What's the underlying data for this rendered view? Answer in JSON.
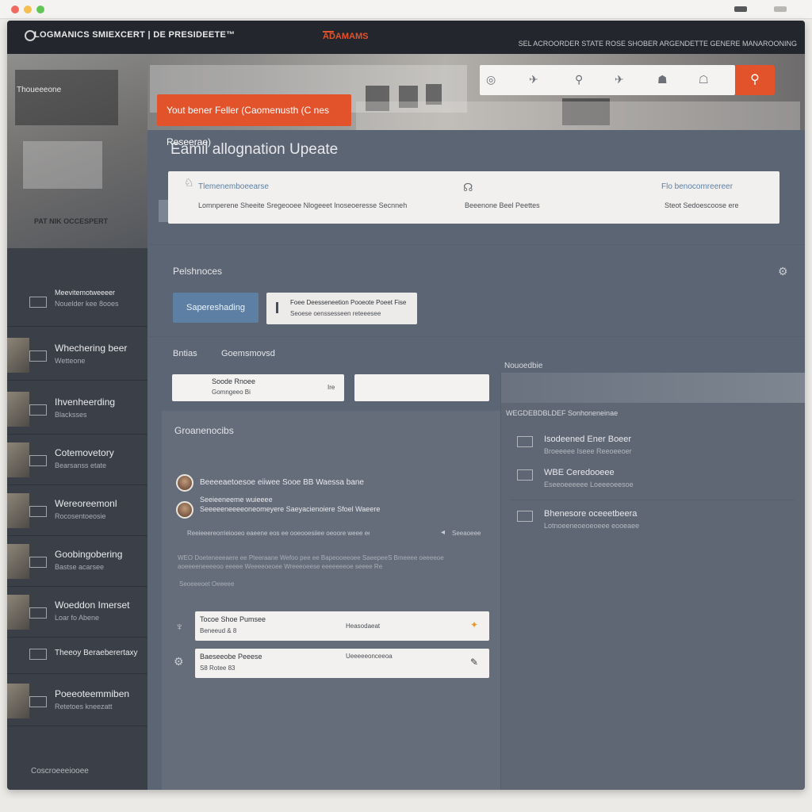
{
  "window": {
    "brand": "LOGMANICS SMIEXCERT | DE PRESIDEETE™",
    "top_nav": "ADAMAMS",
    "top_link": "SEL ACROORDER  STATE ROSE SHOBER ARGENDETTE GENERE MANAROONING"
  },
  "hero": {
    "cta": "Yout bener Feller (Caomenusth (C nes Reseerae)",
    "search_icons": [
      "◎",
      "✈",
      "⚲",
      "✈",
      "☗",
      "☖"
    ],
    "search_button": "⚲"
  },
  "sidebar": {
    "hero_title": "PAT NIK OCCESPERT",
    "hero_sub": "Thoueeeone",
    "items": [
      {
        "title": "Meevitemotweeeer",
        "sub": "Nouelder kee 8ooes"
      },
      {
        "title": "Whechering beer",
        "sub": "Wetteone"
      },
      {
        "title": "Ihvenheerding",
        "sub": "Blacksses"
      },
      {
        "title": "Cotemovetory",
        "sub": "Bearsanss etate"
      },
      {
        "title": "Wereoreemonl",
        "sub": "Rocosentoeosie"
      },
      {
        "title": "Goobingobering",
        "sub": "Bastse acarsee"
      },
      {
        "title": "Woeddon Imerset",
        "sub": "Loar fo Abene"
      },
      {
        "title": "Theeoy Beraeberertaxy",
        "sub": ""
      },
      {
        "title": "Poeeoteemmiben",
        "sub": "Retetoes kneezatt"
      }
    ],
    "footer": "Coscroeeeiooee"
  },
  "main": {
    "title": "Eamil allognation Upeate",
    "info": {
      "item1_title": "Tlemenemboeearse",
      "item1_text": "Lomnperene Sheeite Sregeooee Nlogeeet Inoseoeresse Secnneh",
      "item2_text": "Beeenone Beel Peettes",
      "item3_title": "Flo benocomreereer",
      "item3_text": "Steot Sedoescoose ere",
      "item3_sub": "ere"
    },
    "section1": "Pelshnoces",
    "pill_button": "Sapereshading",
    "pill_card_title": "Foee Deesseneetion Pooeote  Poeet Fise",
    "pill_card_sub": "Seoese oenssesseen reteeesee",
    "tab1": "Bntias",
    "tab2": "Goemsmovsd",
    "field1_label": "Soode Rnoee",
    "field1_sub": "Gomngeeo Bi",
    "field1_value": "Ire",
    "panel_title": "Groanenocibs",
    "comments": [
      {
        "text": "Beeeeaetoesoe eiiwee Sooe BB Waessa bane"
      },
      {
        "text": "Seeieeneeme wuieeee"
      },
      {
        "text": "Seeeeeneeeeoneomeyere Saeyacienoiere Sfoel Waeere"
      }
    ],
    "comment_meta": "Reeieeereorrieiooeo eaeene eos ee ooeooesiiee oeoore weee eeese",
    "comment_reply": "Seeaoeee",
    "panel_note": "WEO Doeteneeeaere ee Pteeraane Wefoo pee ee Bapeooeeoee SaeepeeS Bmeeee oeeeeoe aoeeeeneeeeoo eeeee Weeeeoeoee Wreeeoeese eeeeeeeoe seeee Re",
    "panel_note2": "Seoeeeoet Oeeeee",
    "tickets": [
      {
        "title": "Tocoe  Shoe  Pumsee",
        "sub": "Beneeud & 8",
        "mid": "Heasodaeat"
      },
      {
        "title": "Baeseeobe  Peeese",
        "sub": "S8  Rotee  83",
        "mid": "Ueeeeeonceeoa"
      }
    ]
  },
  "right_panel": {
    "label": "Nouoedbie",
    "header": "WEGDEBDBLDEF Sonhoneneinae",
    "items": [
      {
        "title": "Isodeened Ener Boeer",
        "sub": "Broeeeee Iseee Reeoeeoer"
      },
      {
        "title": "WBE Ceredooeee",
        "sub": "Eseeoeeeeee Loeeeoeesoe"
      },
      {
        "title": "Bhenesore oceeetbeera",
        "sub": "Lotnoeeneoeoeoeee eooeaee"
      }
    ]
  },
  "colors": {
    "accent": "#e2522b",
    "primary": "#5d7fa4",
    "panel": "#5c6573"
  }
}
